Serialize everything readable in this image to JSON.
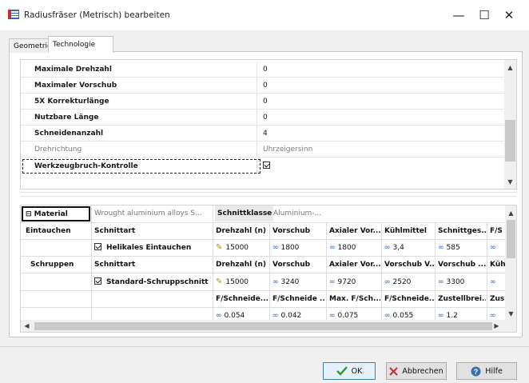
{
  "window": {
    "title": "Radiusfräser (Metrisch) bearbeiten",
    "minimize": "—",
    "maximize": "☐",
    "close": "✕"
  },
  "tabs": [
    {
      "label": "Geometrie",
      "active": false
    },
    {
      "label": "Technologie",
      "active": true
    }
  ],
  "properties": [
    {
      "name": "Maximale Drehzahl",
      "value": "0"
    },
    {
      "name": "Maximaler Vorschub",
      "value": "0"
    },
    {
      "name": "5X Korrekturlänge",
      "value": "0"
    },
    {
      "name": "Nutzbare Länge",
      "value": "0"
    },
    {
      "name": "Schneidenanzahl",
      "value": "4"
    },
    {
      "name": "Drehrichtung",
      "value": "Uhrzeigersinn"
    },
    {
      "name": "Werkzeugbruch-Kontrolle",
      "value": ""
    }
  ],
  "material_grid": {
    "header": {
      "material_label": "⊟ Material",
      "material_value": "Wrought aluminium alloys S...",
      "schnittklasse_label": "Schnittklasse",
      "schnittklasse_value": "Aluminium-..."
    },
    "eintauchen": {
      "label": "Eintauchen",
      "headers": [
        "Schnittart",
        "Drehzahl (n)",
        "Vorschub",
        "Axialer Vor...",
        "Kühlmittel",
        "Schnittges...",
        "F/S"
      ],
      "values": [
        "Helikales Eintauchen",
        "15000",
        "1800",
        "1800",
        "3,4",
        "585"
      ]
    },
    "schruppen": {
      "label": "Schruppen",
      "headers": [
        "Schnittart",
        "Drehzahl (n)",
        "Vorschub",
        "Axialer Vor...",
        "Vorschub V...",
        "Vorschub ...",
        "Küh"
      ],
      "values": [
        "Standard-Schruppschnitt",
        "15000",
        "3240",
        "9720",
        "2520",
        "3300"
      ],
      "headers2": [
        "F/Schneide...",
        "F/Schneide ...",
        "Max. F/Sch...",
        "F/Schneide...",
        "Zustellbrei...",
        "Zus"
      ],
      "values2": [
        "0.054",
        "0.042",
        "0.075",
        "0.055",
        "1.2"
      ]
    }
  },
  "buttons": {
    "ok": "OK",
    "cancel": "Abbrechen",
    "help": "Hilfe"
  },
  "icons": {
    "pencil": "✎",
    "link": "∞"
  }
}
